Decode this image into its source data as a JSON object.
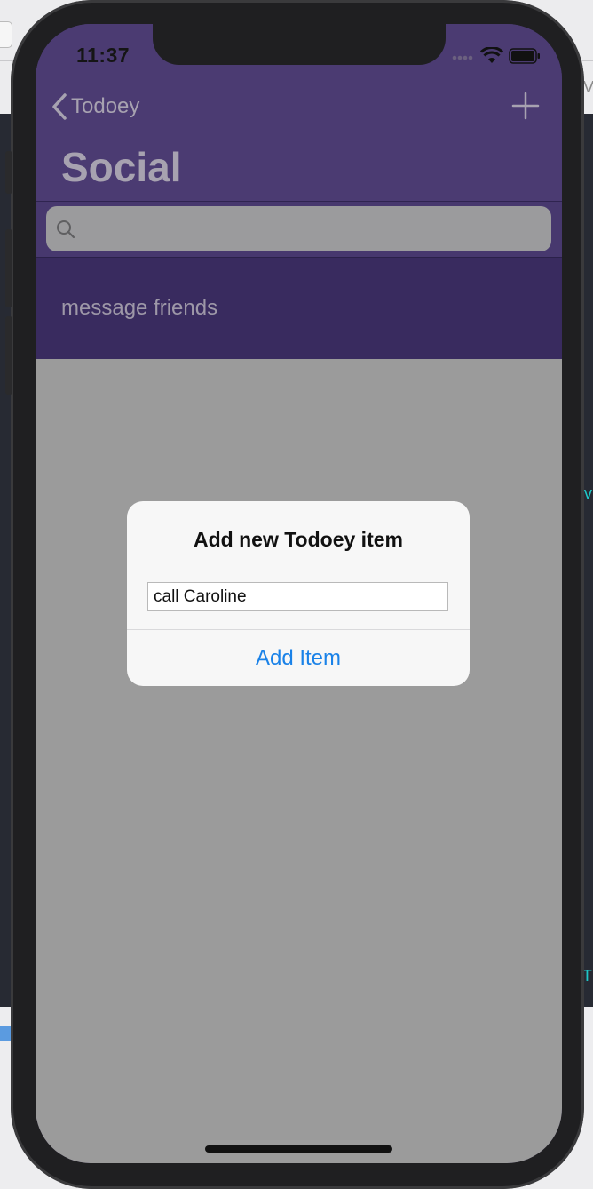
{
  "status_bar": {
    "time": "11:37"
  },
  "nav": {
    "back_label": "Todoey",
    "title": "Social"
  },
  "search": {
    "placeholder": "",
    "value": ""
  },
  "items": [
    {
      "title": "message friends"
    }
  ],
  "alert": {
    "title": "Add new Todoey item",
    "text_field_value": "call Caroline",
    "action_label": "Add Item"
  },
  "colors": {
    "nav_background": "#4b3b72",
    "alert_action": "#1a82e8",
    "dim_overlay": "#9b9b9b"
  },
  "icons": [
    "chevron-left-icon",
    "plus-icon",
    "search-icon",
    "signal-icon",
    "wifi-icon",
    "battery-icon"
  ]
}
